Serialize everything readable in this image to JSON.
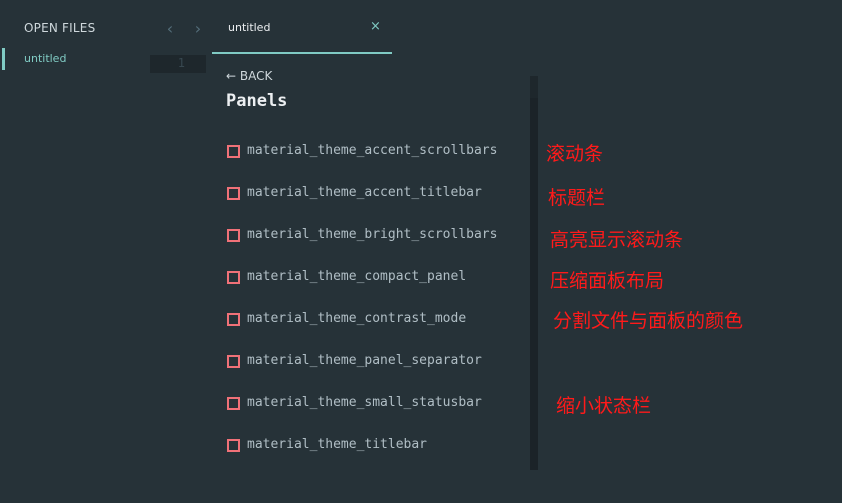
{
  "sidebar": {
    "header": "OPEN FILES",
    "items": [
      {
        "label": "untitled"
      }
    ]
  },
  "nav": {
    "back_glyph": "‹",
    "forward_glyph": "›"
  },
  "tab": {
    "label": "untitled",
    "close_glyph": "×"
  },
  "editor": {
    "line_number": "1"
  },
  "panel": {
    "back_label": "← BACK",
    "title": "Panels",
    "options": [
      {
        "label": "material_theme_accent_scrollbars"
      },
      {
        "label": "material_theme_accent_titlebar"
      },
      {
        "label": "material_theme_bright_scrollbars"
      },
      {
        "label": "material_theme_compact_panel"
      },
      {
        "label": "material_theme_contrast_mode"
      },
      {
        "label": "material_theme_panel_separator"
      },
      {
        "label": "material_theme_small_statusbar"
      },
      {
        "label": "material_theme_titlebar"
      }
    ]
  },
  "annotations": [
    "滚动条",
    "标题栏",
    "高亮显示滚动条",
    "压缩面板布局",
    "分割文件与面板的颜色",
    "缩小状态栏"
  ],
  "colors": {
    "background": "#263238",
    "accent": "#80cbc4",
    "checkbox": "#f07178",
    "annotation": "#ff1a1a"
  }
}
